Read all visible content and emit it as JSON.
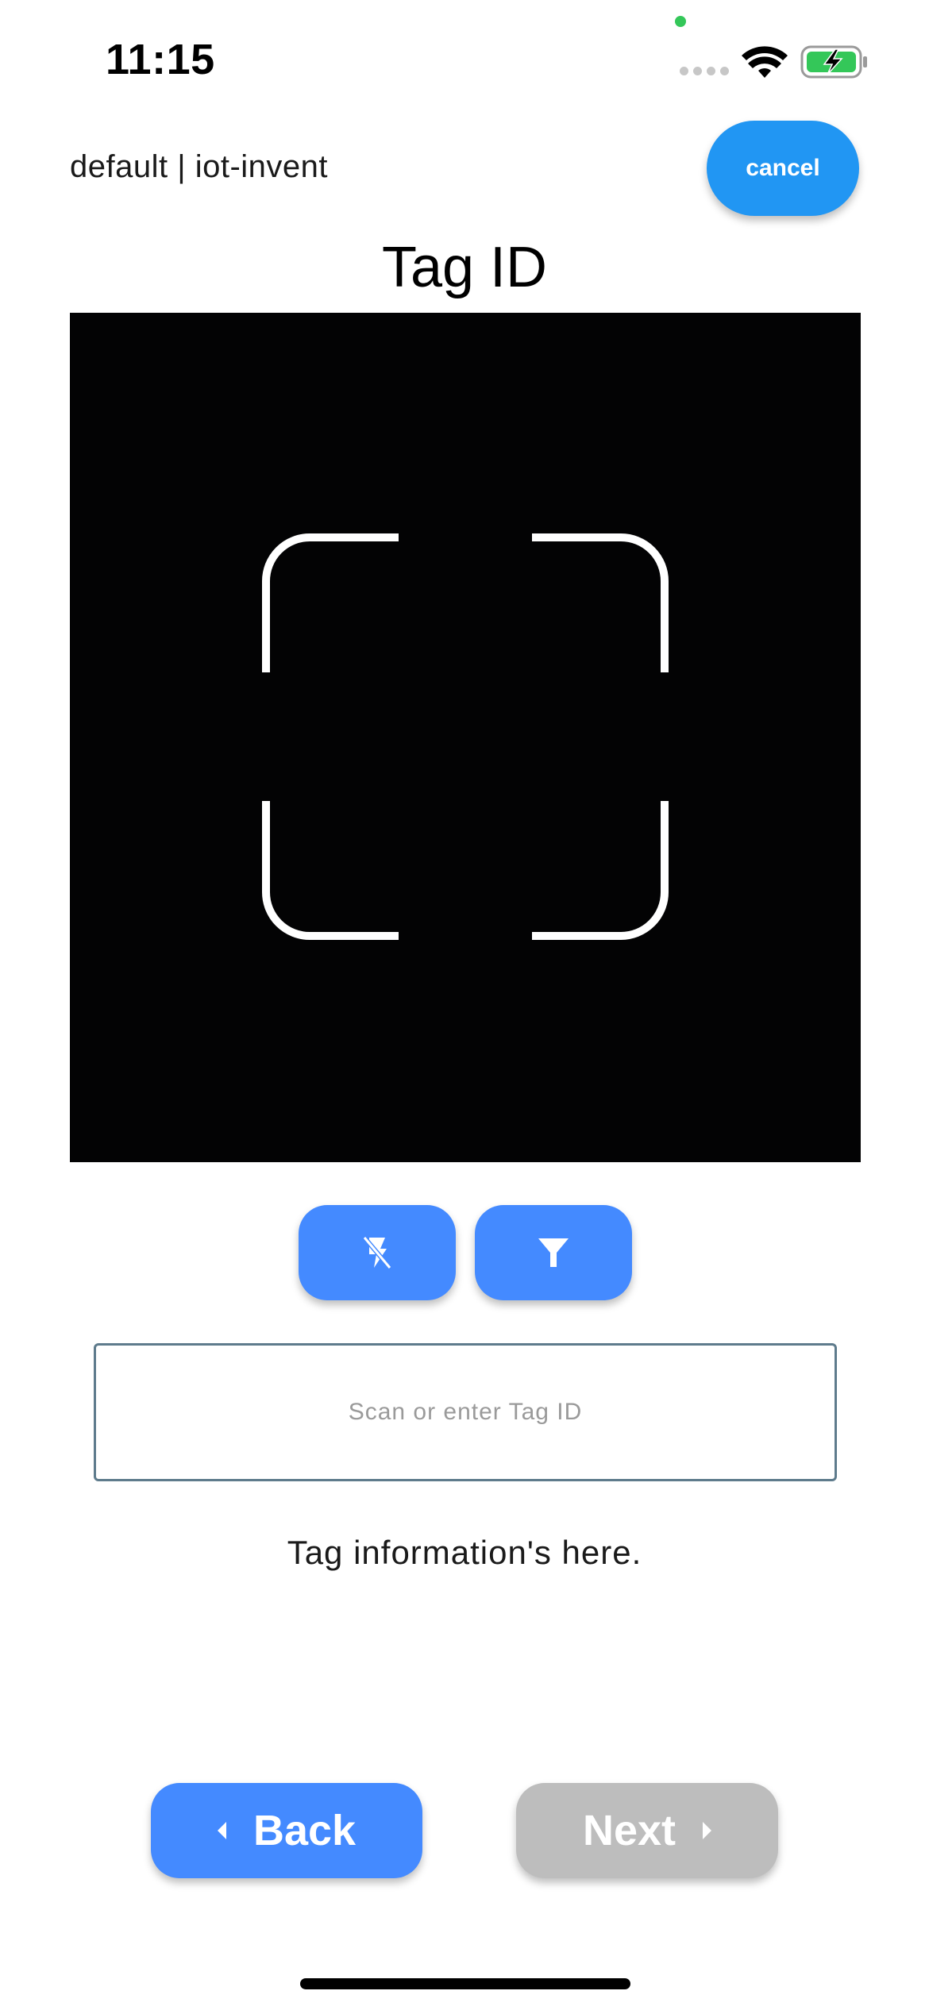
{
  "status_bar": {
    "time": "11:15",
    "icons": [
      "signal-icon",
      "wifi-icon",
      "battery-charging-icon"
    ],
    "battery_color": "#34c759"
  },
  "header": {
    "breadcrumb": "default | iot-invent",
    "cancel_label": "cancel",
    "title": "Tag ID"
  },
  "scanner": {
    "frame_icon": "scan-frame-icon",
    "buttons": [
      {
        "icon": "flash-off-icon"
      },
      {
        "icon": "filter-icon"
      }
    ]
  },
  "input": {
    "value": "",
    "placeholder": "Scan or enter Tag ID"
  },
  "info_text": "Tag information's here.",
  "navigation": {
    "back_label": "Back",
    "next_label": "Next",
    "next_enabled": false
  },
  "colors": {
    "primary": "#2196f3",
    "button_blue": "#448aff",
    "disabled": "#bdbdbd"
  }
}
